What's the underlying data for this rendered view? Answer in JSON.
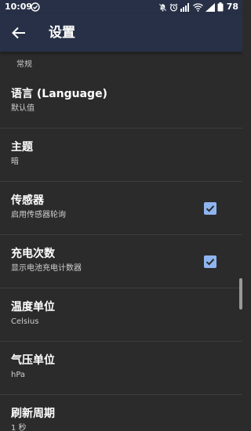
{
  "status_bar": {
    "time": "10:09",
    "battery": "78"
  },
  "app_bar": {
    "title": "设置"
  },
  "section": {
    "general": "常规"
  },
  "settings": {
    "language": {
      "title": "语言 (Language)",
      "value": "默认值"
    },
    "theme": {
      "title": "主题",
      "value": "暗"
    },
    "sensor": {
      "title": "传感器",
      "value": "启用传感器轮询",
      "checked": true
    },
    "charge_count": {
      "title": "充电次数",
      "value": "显示电池充电计数器",
      "checked": true
    },
    "temp_unit": {
      "title": "温度单位",
      "value": "Celsius"
    },
    "pressure_unit": {
      "title": "气压单位",
      "value": "hPa"
    },
    "refresh_period": {
      "title": "刷新周期",
      "value": "1 秒"
    }
  },
  "colors": {
    "app_bar": "#273046",
    "background": "#2b2b2b",
    "checkbox": "#8fb5f0"
  }
}
